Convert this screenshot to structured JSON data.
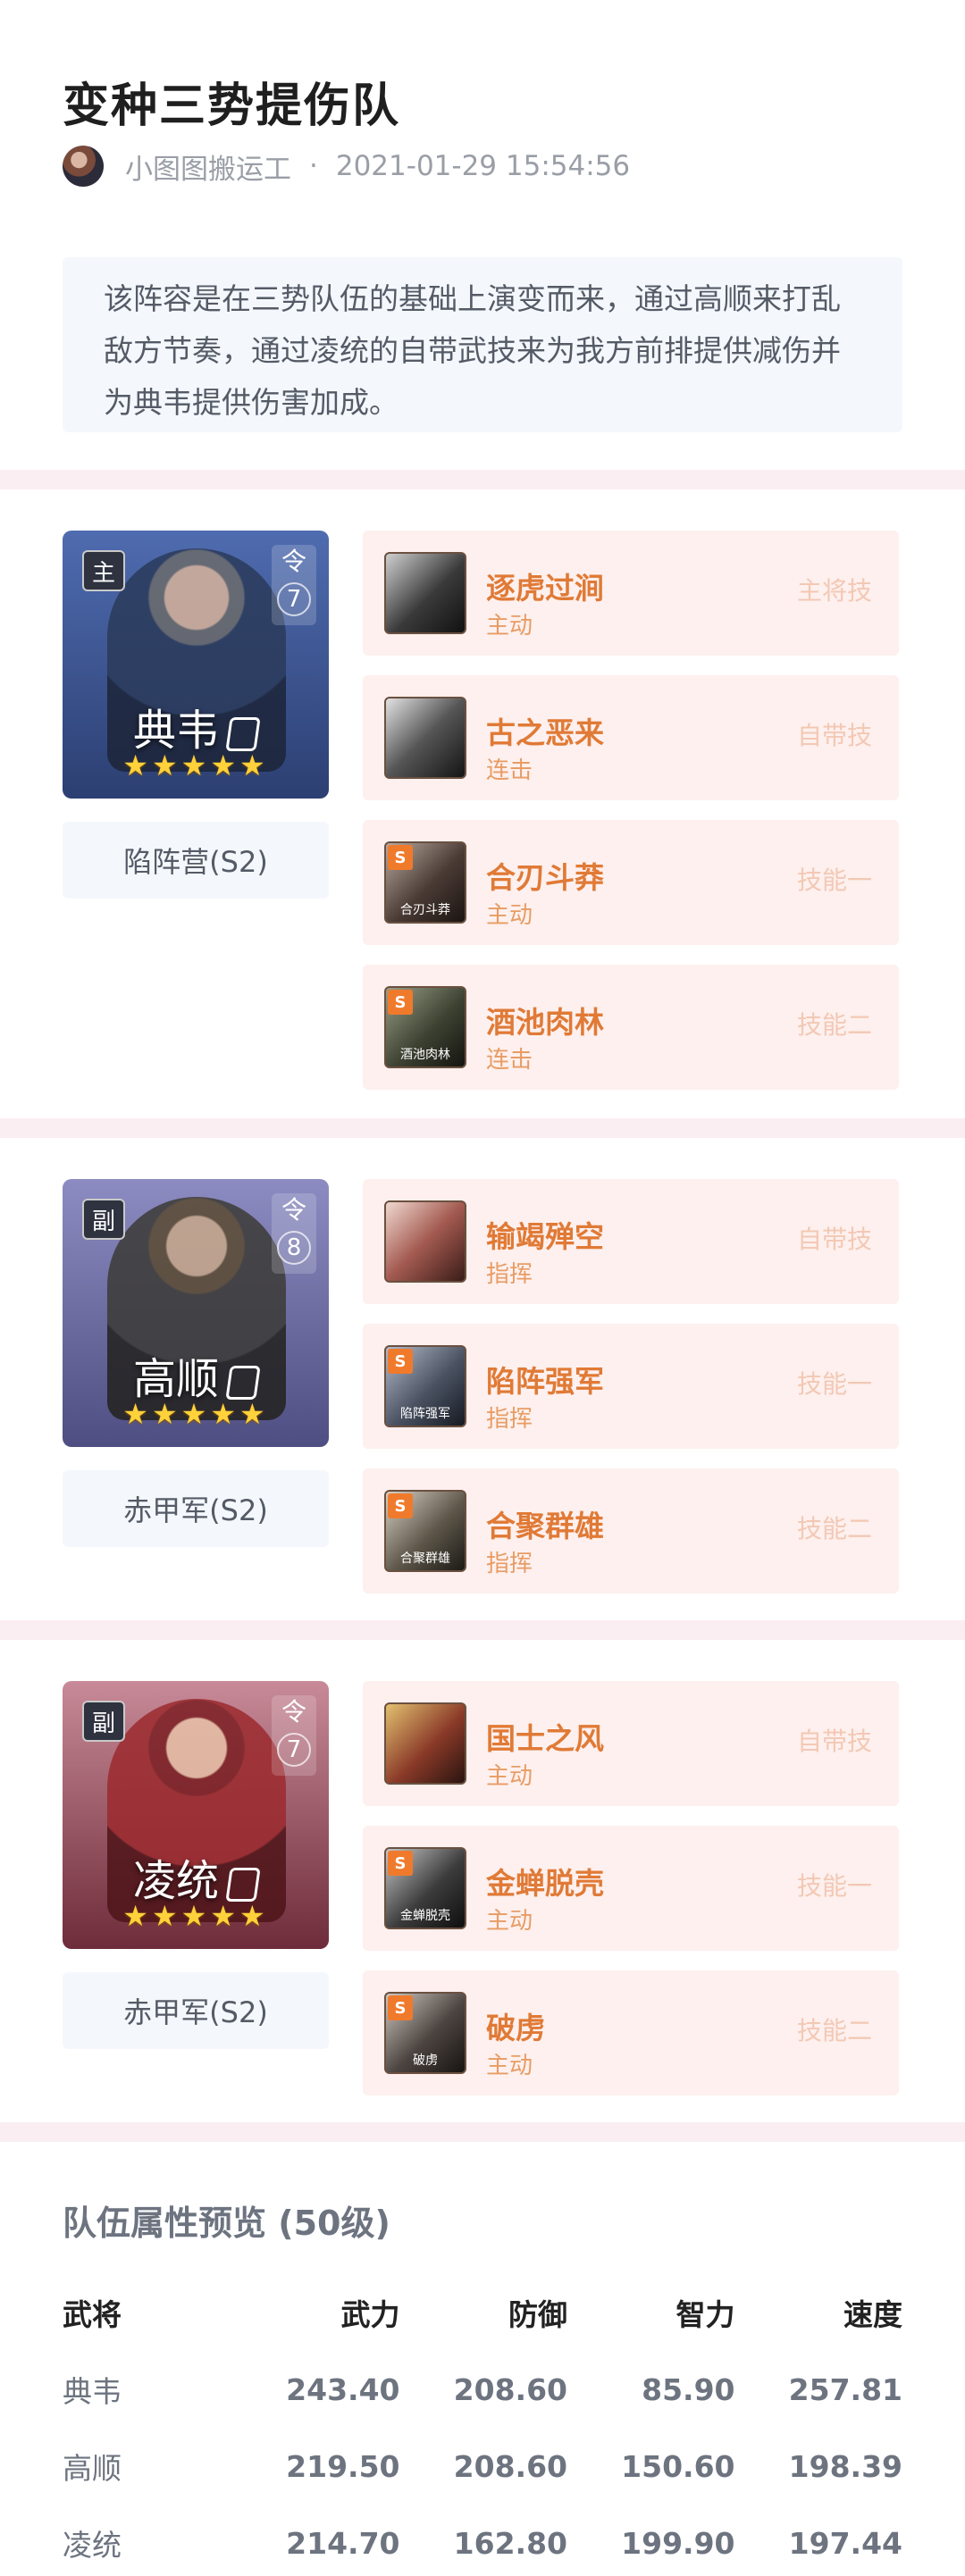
{
  "article": {
    "title": "变种三势提伤队",
    "author": "小图图搬运工",
    "separator": "·",
    "datetime": "2021-01-29 15:54:56",
    "intro": "该阵容是在三势队伍的基础上演变而来，通过高顺来打乱敌方节奏，通过凌统的自带武技来为我方前排提供减伤并为典韦提供伤害加成。"
  },
  "heroes": [
    {
      "role": "主",
      "name": "典韦",
      "ling": "令",
      "ling_num": "7",
      "stars": "★★★★★",
      "army": "陷阵营(S2)",
      "bg": "#3f5a98",
      "skills": [
        {
          "name": "逐虎过涧",
          "type": "主动",
          "slot": "主将技",
          "badge": "",
          "caption": ""
        },
        {
          "name": "古之恶来",
          "type": "连击",
          "slot": "自带技",
          "badge": "",
          "caption": ""
        },
        {
          "name": "合刃斗莽",
          "type": "主动",
          "slot": "技能一",
          "badge": "S",
          "caption": "合刃斗莽"
        },
        {
          "name": "酒池肉林",
          "type": "连击",
          "slot": "技能二",
          "badge": "S",
          "caption": "酒池肉林"
        }
      ]
    },
    {
      "role": "副",
      "name": "高顺",
      "ling": "令",
      "ling_num": "8",
      "stars": "★★★★★",
      "army": "赤甲军(S2)",
      "bg": "#6a6aa0",
      "skills": [
        {
          "name": "输竭殚空",
          "type": "指挥",
          "slot": "自带技",
          "badge": "",
          "caption": ""
        },
        {
          "name": "陷阵强军",
          "type": "指挥",
          "slot": "技能一",
          "badge": "S",
          "caption": "陷阵强军"
        },
        {
          "name": "合聚群雄",
          "type": "指挥",
          "slot": "技能二",
          "badge": "S",
          "caption": "合聚群雄"
        }
      ]
    },
    {
      "role": "副",
      "name": "凌统",
      "ling": "令",
      "ling_num": "7",
      "stars": "★★★★★",
      "army": "赤甲军(S2)",
      "bg": "#8a4656",
      "skills": [
        {
          "name": "国士之风",
          "type": "主动",
          "slot": "自带技",
          "badge": "",
          "caption": ""
        },
        {
          "name": "金蝉脱壳",
          "type": "主动",
          "slot": "技能一",
          "badge": "S",
          "caption": "金蝉脱壳"
        },
        {
          "name": "破虏",
          "type": "主动",
          "slot": "技能二",
          "badge": "S",
          "caption": "破虏"
        }
      ]
    }
  ],
  "stats": {
    "title": "队伍属性预览 (50级)",
    "headers": [
      "武将",
      "武力",
      "防御",
      "智力",
      "速度"
    ],
    "rows": [
      [
        "典韦",
        "243.40",
        "208.60",
        "85.90",
        "257.81"
      ],
      [
        "高顺",
        "219.50",
        "208.60",
        "150.60",
        "198.39"
      ],
      [
        "凌统",
        "214.70",
        "162.80",
        "199.90",
        "197.44"
      ]
    ]
  }
}
